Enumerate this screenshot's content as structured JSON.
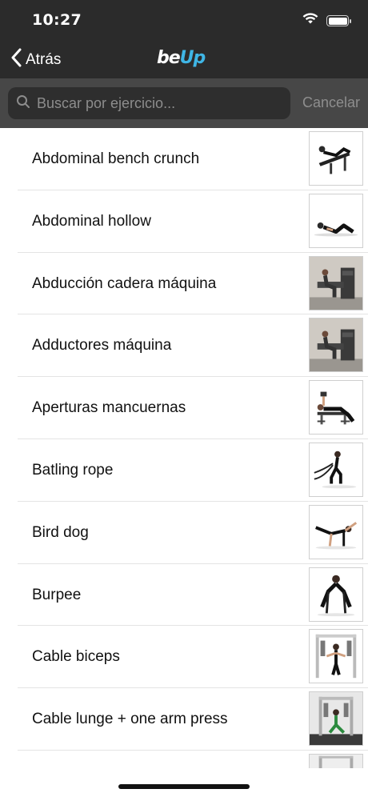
{
  "status": {
    "time": "10:27"
  },
  "nav": {
    "back_label": "Atrás",
    "logo_left": "be",
    "logo_right": "Up"
  },
  "search": {
    "placeholder": "Buscar por ejercicio...",
    "cancel_label": "Cancelar"
  },
  "exercises": [
    {
      "label": "Abdominal bench crunch",
      "thumb": "bench-crunch"
    },
    {
      "label": "Abdominal hollow",
      "thumb": "hollow"
    },
    {
      "label": "Abducción cadera máquina",
      "thumb": "machine"
    },
    {
      "label": "Adductores máquina",
      "thumb": "machine"
    },
    {
      "label": "Aperturas mancuernas",
      "thumb": "bench"
    },
    {
      "label": "Batling rope",
      "thumb": "rope"
    },
    {
      "label": "Bird dog",
      "thumb": "birddog"
    },
    {
      "label": "Burpee",
      "thumb": "burpee"
    },
    {
      "label": "Cable biceps",
      "thumb": "cable"
    },
    {
      "label": "Cable lunge + one arm press",
      "thumb": "cable-lunge"
    }
  ]
}
